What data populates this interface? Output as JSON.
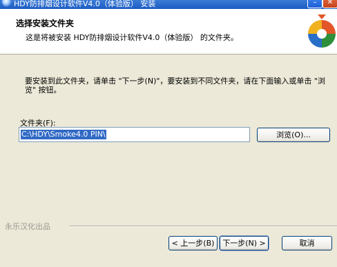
{
  "window": {
    "title": "HDY防排烟设计软件V4.0（体验版） 安装",
    "minimize_symbol": "–",
    "close_symbol": "✕"
  },
  "header": {
    "title": "选择安装文件夹",
    "subtitle": "这是将被安装 HDY防排烟设计软件V4.0（体验版） 的文件夹。"
  },
  "body": {
    "instruction": "要安装到此文件夹，请单击 \"下一步(N)\"，要安装到不同文件夹，请在下面输入或单击 \"浏览\" 按钮。",
    "folder_label": "文件夹(F):",
    "folder_value": "C:\\HDY\\Smoke4.0 PIN\\",
    "browse_label": "浏览(O)..."
  },
  "footer": {
    "brand": "永乐汉化出品",
    "back_label": "< 上一步(B)",
    "next_label": "下一步(N) >",
    "cancel_label": "取消"
  },
  "icons": [
    "app-icon",
    "minimize-icon",
    "close-icon",
    "installer-logo-icon"
  ],
  "colors": {
    "titlebar": "#1c5bc4",
    "selection": "#316ac5",
    "dialog_bg": "#ece9d8"
  }
}
